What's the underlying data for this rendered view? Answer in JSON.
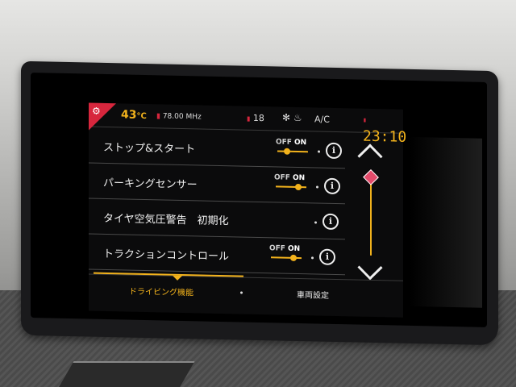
{
  "status_bar": {
    "temperature": "43",
    "temperature_unit": "°C",
    "radio_frequency": "78.00 MHz",
    "fan_level": "18",
    "ac_label": "A/C",
    "clock": "23:10"
  },
  "settings": [
    {
      "label": "ストップ&スタート",
      "has_toggle": true,
      "off_label": "OFF",
      "on_label": "ON"
    },
    {
      "label": "パーキングセンサー",
      "has_toggle": true,
      "off_label": "OFF",
      "on_label": "ON"
    },
    {
      "label": "タイヤ空気圧警告　初期化",
      "has_toggle": false
    },
    {
      "label": "トラクションコントロール",
      "has_toggle": true,
      "off_label": "OFF",
      "on_label": "ON"
    }
  ],
  "tabs": {
    "active": "ドライビング機能",
    "other": "車両設定"
  },
  "colors": {
    "accent": "#f2b21c",
    "alert": "#d7263d",
    "background": "#0b0b0c"
  }
}
